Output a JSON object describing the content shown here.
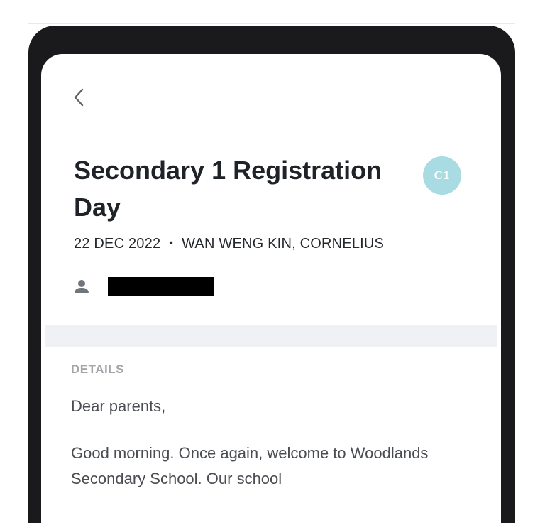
{
  "event": {
    "title": "Secondary 1 Registration Day",
    "avatar_initials": "C1",
    "date": "22 DEC 2022",
    "separator": "•",
    "author": "WAN WENG KIN, CORNELIUS"
  },
  "details": {
    "section_label": "DETAILS",
    "paragraphs": [
      "Dear parents,",
      "Good morning. Once again, welcome to Woodlands Secondary School. Our school"
    ]
  },
  "colors": {
    "avatar_bg": "#a8dbe2",
    "frame": "#1a1a1c",
    "band": "#f0f1f4"
  },
  "icons": {
    "back": "chevron-left-icon",
    "person": "person-icon"
  }
}
